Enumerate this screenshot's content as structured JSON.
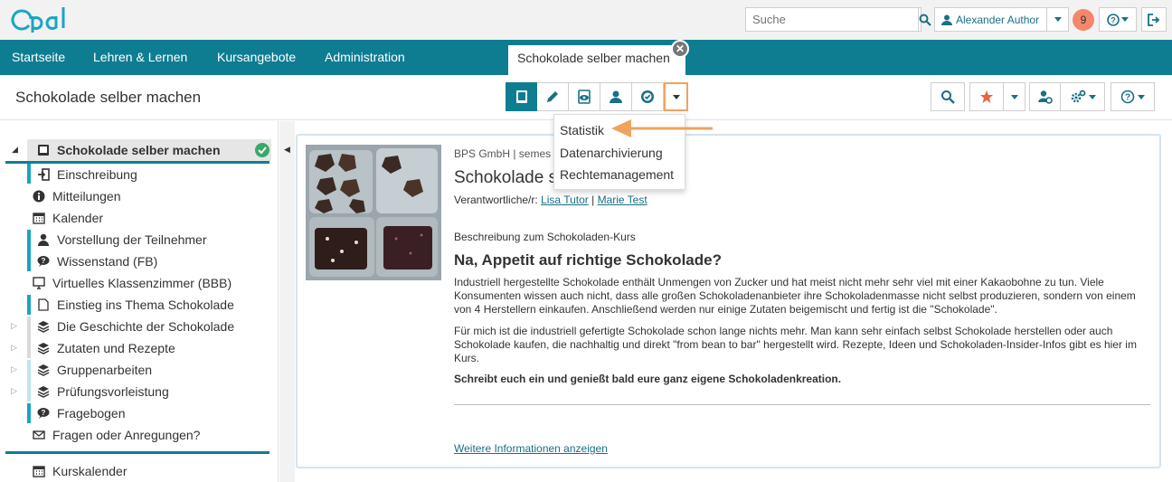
{
  "header": {
    "logo_text": "Opal",
    "search_placeholder": "Suche",
    "user_name": "Alexander Author",
    "notification_count": "9"
  },
  "nav": {
    "items": [
      "Startseite",
      "Lehren & Lernen",
      "Kursangebote",
      "Administration"
    ],
    "active_tab": "Schokolade selber machen"
  },
  "toolbar": {
    "title": "Schokolade selber machen"
  },
  "dropdown": {
    "items": [
      "Statistik",
      "Datenarchivierung",
      "Rechtemanagement"
    ]
  },
  "sidebar": {
    "root": "Schokolade selber machen",
    "items": [
      {
        "label": "Einschreibung",
        "icon": "enrollment-icon"
      },
      {
        "label": "Mitteilungen",
        "icon": "info-icon"
      },
      {
        "label": "Kalender",
        "icon": "calendar-icon"
      },
      {
        "label": "Vorstellung der Teilnehmer",
        "icon": "user-icon"
      },
      {
        "label": "Wissenstand (FB)",
        "icon": "forum-icon"
      },
      {
        "label": "Virtuelles Klassenzimmer (BBB)",
        "icon": "monitor-icon"
      },
      {
        "label": "Einstieg ins Thema Schokolade",
        "icon": "page-icon"
      },
      {
        "label": "Die Geschichte der Schokolade",
        "icon": "layers-icon"
      },
      {
        "label": "Zutaten und Rezepte",
        "icon": "layers-icon"
      },
      {
        "label": "Gruppenarbeiten",
        "icon": "layers-icon"
      },
      {
        "label": "Prüfungsvorleistung",
        "icon": "layers-icon"
      },
      {
        "label": "Fragebogen",
        "icon": "forum-icon"
      },
      {
        "label": "Fragen oder Anregungen?",
        "icon": "mail-icon"
      }
    ],
    "footer_item": "Kurskalender"
  },
  "course": {
    "meta": "BPS GmbH | semes",
    "title": "Schokolade se",
    "responsible_label": "Verantwortliche/r:",
    "responsible": [
      "Lisa Tutor",
      "Marie Test"
    ],
    "description_label": "Beschreibung zum Schokoladen-Kurs",
    "heading": "Na, Appetit auf richtige Schokolade?",
    "para1": "Industriell hergestellte Schokolade enthält Unmengen von Zucker und hat meist nicht mehr sehr viel mit einer Kakaobohne zu tun. Viele Konsumenten wissen auch nicht, dass alle großen Schokoladenanbieter ihre Schokoladenmasse nicht selbst produzieren, sondern von einem von 4 Herstellern einkaufen. Anschließend werden nur einige Zutaten beigemischt und fertig ist die \"Schokolade\".",
    "para2": "Für mich ist die industriell gefertigte Schokolade schon lange nichts mehr. Man kann sehr einfach selbst Schokolade herstellen oder auch Schokolade kaufen, die nachhaltig und direkt \"from bean to bar\" hergestellt wird. Rezepte, Ideen und Schokoladen-Insider-Infos gibt es hier im Kurs.",
    "para3": "Schreibt euch ein und genießt bald eure ganz eigene Schokoladenkreation.",
    "more_link": "Weitere Informationen anzeigen"
  },
  "colors": {
    "brand": "#0e7d92",
    "accent_orange": "#f0a35e",
    "badge": "#f4876b",
    "tree_bar": "#19a5c3",
    "check": "#3aa86b"
  }
}
